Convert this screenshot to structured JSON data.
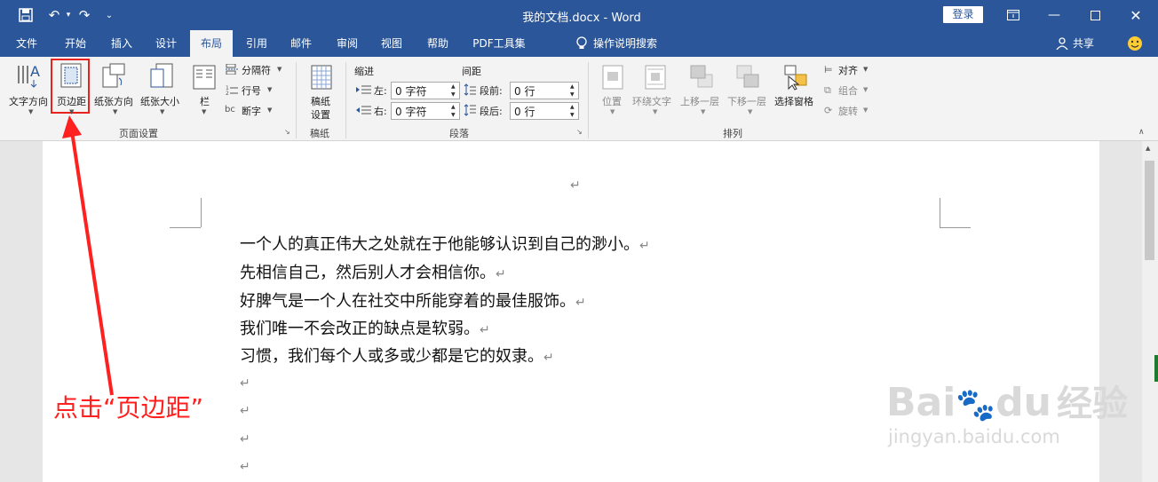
{
  "window": {
    "title": "我的文档.docx  -  Word",
    "login_label": "登录"
  },
  "tabs": [
    "文件",
    "开始",
    "插入",
    "设计",
    "布局",
    "引用",
    "邮件",
    "审阅",
    "视图",
    "帮助",
    "PDF工具集"
  ],
  "active_tab": "布局",
  "tell_me": "操作说明搜索",
  "share_label": "共享",
  "ribbon": {
    "page_setup": {
      "text_direction": "文字方向",
      "margins": "页边距",
      "orientation": "纸张方向",
      "size": "纸张大小",
      "columns": "栏",
      "breaks": "分隔符",
      "line_numbers": "行号",
      "hyphenation": "断字",
      "group_label": "页面设置"
    },
    "draft": {
      "button": "稿纸\n设置",
      "button_line1": "稿纸",
      "button_line2": "设置",
      "group_label": "稿纸"
    },
    "paragraph": {
      "indent_label": "缩进",
      "spacing_label": "间距",
      "left_label": "左:",
      "right_label": "右:",
      "before_label": "段前:",
      "after_label": "段后:",
      "left_value": "0 字符",
      "right_value": "0 字符",
      "before_value": "0 行",
      "after_value": "0 行",
      "group_label": "段落"
    },
    "arrange": {
      "position": "位置",
      "wrap_text": "环绕文字",
      "bring_forward": "上移一层",
      "send_backward": "下移一层",
      "selection_pane": "选择窗格",
      "align": "对齐",
      "group": "组合",
      "rotate": "旋转",
      "group_label": "排列"
    }
  },
  "document": {
    "lines": [
      "一个人的真正伟大之处就在于他能够认识到自己的渺小。",
      "先相信自己，然后别人才会相信你。",
      "好脾气是一个人在社交中所能穿着的最佳服饰。",
      "我们唯一不会改正的缺点是软弱。",
      "习惯，我们每个人或多或少都是它的奴隶。"
    ],
    "paragraph_mark": "↵"
  },
  "annotation": "点击“页边距”",
  "watermark": {
    "brand": "Bai",
    "brand2": "du",
    "cn": "经验",
    "url": "jingyan.baidu.com"
  },
  "colors": {
    "title_bar": "#2b579a",
    "annotation": "#ff2020",
    "highlight_box": "#e8231e"
  }
}
